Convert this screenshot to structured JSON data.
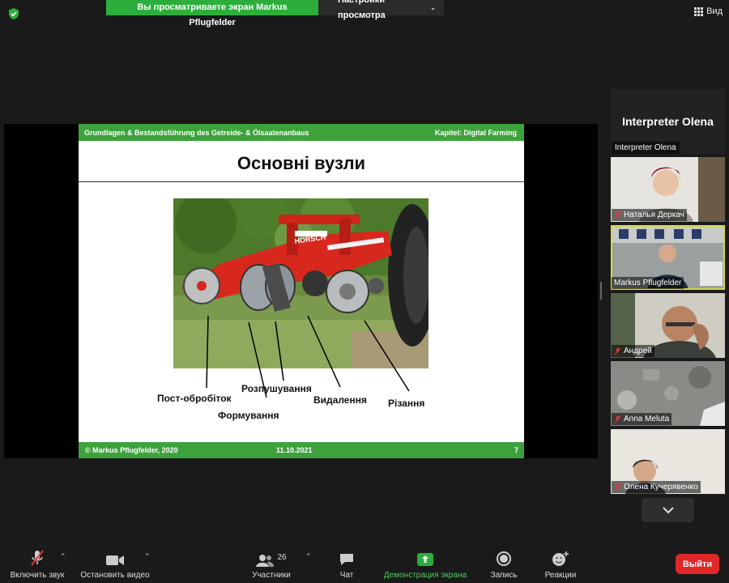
{
  "topbar": {
    "share_banner": "Вы просматриваете экран Markus Pflugfelder",
    "view_options": "Настройки просмотра",
    "view_button": "Вид"
  },
  "slide": {
    "header_left": "Grundlagen & Bestandsführung des Getreide- & Ölsaatenanbaus",
    "header_right": "Kapitel: Digital Farming",
    "title": "Основні вузли",
    "photo_brand": "HORSCH",
    "labels": {
      "post": "Пост-обробіток",
      "form": "Формування",
      "loosen": "Розпушування",
      "remove": "Видалення",
      "cut": "Різання"
    },
    "footer_left": "© Markus Pflugfelder, 2020",
    "footer_date": "11.10.2021",
    "footer_page": "7"
  },
  "participants": {
    "interpreter_big": "Interpreter Olena",
    "interpreter_small": "Interpreter Olena",
    "tiles": [
      {
        "name": "Наталья Деркач",
        "muted": true
      },
      {
        "name": "Markus Pflugfelder",
        "muted": false,
        "active": true
      },
      {
        "name": "Андрей",
        "muted": true
      },
      {
        "name": "Anna Meluta",
        "muted": true
      },
      {
        "name": "Олена Кучерявенко",
        "muted": true
      }
    ]
  },
  "toolbar": {
    "audio": "Включить звук",
    "video": "Остановить видео",
    "participants": "Участники",
    "participants_count": "26",
    "chat": "Чат",
    "share": "Демонстрация экрана",
    "record": "Запись",
    "reactions": "Реакции",
    "leave": "Выйти"
  },
  "colors": {
    "slide_green": "#3ea23c",
    "share_green": "#2dae3c",
    "active_outline": "#d7db3a",
    "leave_red": "#e02828",
    "machine_red": "#d8281e"
  }
}
